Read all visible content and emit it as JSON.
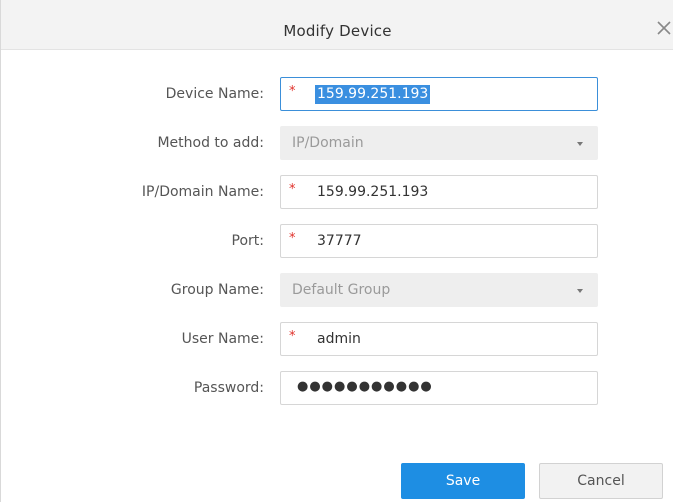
{
  "dialog": {
    "title": "Modify Device"
  },
  "form": {
    "device_name": {
      "label": "Device Name:",
      "value": "159.99.251.193",
      "required_mark": "*"
    },
    "method_to_add": {
      "label": "Method to add:",
      "value": "IP/Domain"
    },
    "ip_domain_name": {
      "label": "IP/Domain Name:",
      "value": "159.99.251.193",
      "required_mark": "*"
    },
    "port": {
      "label": "Port:",
      "value": "37777",
      "required_mark": "*"
    },
    "group_name": {
      "label": "Group Name:",
      "value": "Default Group"
    },
    "user_name": {
      "label": "User Name:",
      "value": "admin",
      "required_mark": "*"
    },
    "password": {
      "label": "Password:",
      "value": "●●●●●●●●●●●"
    }
  },
  "buttons": {
    "save": "Save",
    "cancel": "Cancel"
  },
  "icons": {
    "close": "close-icon",
    "dropdown": "chevron-down-icon"
  },
  "colors": {
    "accent": "#1e8ee3",
    "required": "#e0302a",
    "selection": "#3a8fe0"
  }
}
